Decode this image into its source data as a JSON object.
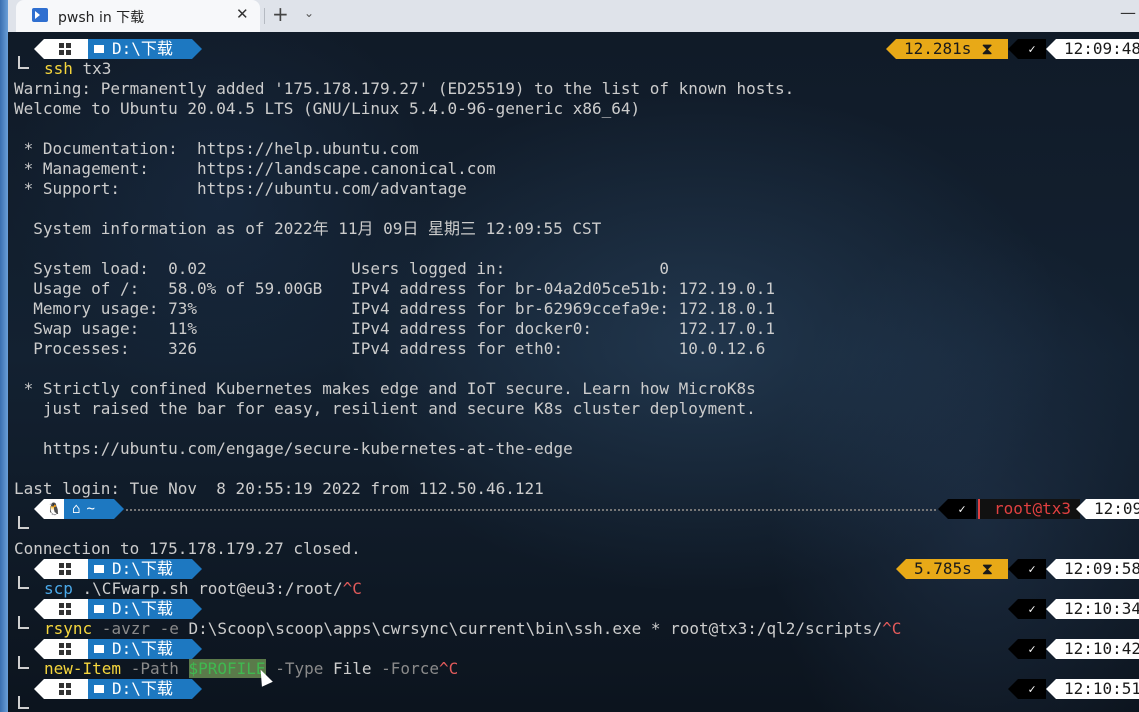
{
  "window": {
    "tab_title": "pwsh in 下载",
    "close_glyph": "✕",
    "new_tab_glyph": "+",
    "dropdown_glyph": "⌄",
    "minimize_glyph": "—"
  },
  "prompt": {
    "path": "D:\\下载",
    "home_path": "~",
    "user_host": "root@tx3"
  },
  "blocks": [
    {
      "duration": "12.281s",
      "time": "12:09:48",
      "command": "ssh",
      "args": " tx3"
    }
  ],
  "output": [
    "Warning: Permanently added '175.178.179.27' (ED25519) to the list of known hosts.",
    "Welcome to Ubuntu 20.04.5 LTS (GNU/Linux 5.4.0-96-generic x86_64)",
    "",
    " * Documentation:  https://help.ubuntu.com",
    " * Management:     https://landscape.canonical.com",
    " * Support:        https://ubuntu.com/advantage",
    "",
    "  System information as of 2022年 11月 09日 星期三 12:09:55 CST",
    "",
    "  System load:  0.02               Users logged in:                0",
    "  Usage of /:   58.0% of 59.00GB   IPv4 address for br-04a2d05ce51b: 172.19.0.1",
    "  Memory usage: 73%                IPv4 address for br-62969ccefa9e: 172.18.0.1",
    "  Swap usage:   11%                IPv4 address for docker0:         172.17.0.1",
    "  Processes:    326                IPv4 address for eth0:            10.0.12.6",
    "",
    " * Strictly confined Kubernetes makes edge and IoT secure. Learn how MicroK8s",
    "   just raised the bar for easy, resilient and secure K8s cluster deployment.",
    "",
    "   https://ubuntu.com/engage/secure-kubernetes-at-the-edge",
    "",
    "Last login: Tue Nov  8 20:55:19 2022 from 112.50.46.121"
  ],
  "remote_prompt": {
    "time": "12:09"
  },
  "closed_line": "Connection to 175.178.179.27 closed.",
  "scp": {
    "duration": "5.785s",
    "time": "12:09:58",
    "command": "scp",
    "args": " .\\CFwarp.sh root@eu3:/root/",
    "interrupt": "^C"
  },
  "rsync": {
    "time": "12:10:34",
    "command": "rsync",
    "flag": " -avzr -e",
    "args": " D:\\Scoop\\scoop\\apps\\cwrsync\\current\\bin\\ssh.exe * root@tx3:/ql2/scripts/",
    "interrupt": "^C"
  },
  "newitem": {
    "time": "12:10:42",
    "command": "new-Item",
    "flag_path": " -Path ",
    "variable": "$PROFILE",
    "flag_type": " -Type ",
    "type_value": "File",
    "flag_force": " -Force",
    "interrupt": "^C"
  },
  "last": {
    "time": "12:10:51"
  },
  "icons": {
    "check": "✓",
    "hourglass": "⧗",
    "linux": "🐧",
    "home": "⌂"
  }
}
